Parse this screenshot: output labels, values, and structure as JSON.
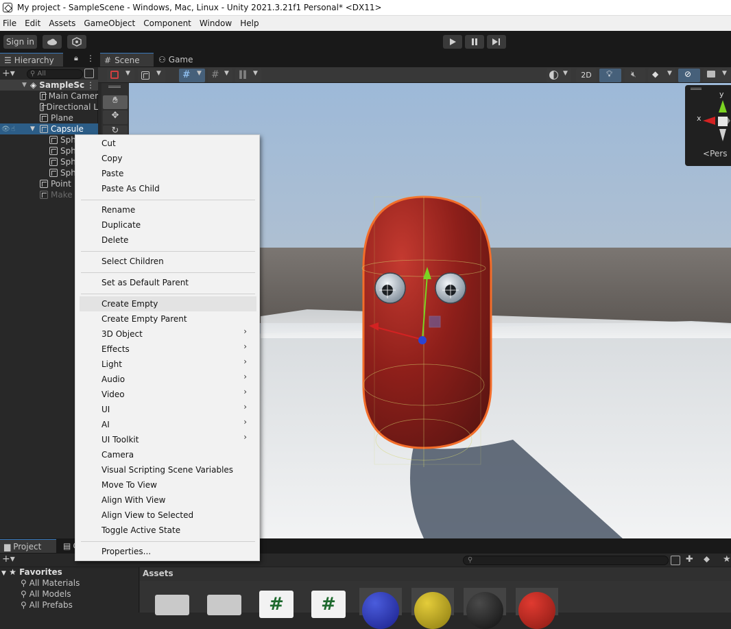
{
  "window": {
    "title": "My project - SampleScene - Windows, Mac, Linux - Unity 2021.3.21f1 Personal* <DX11>"
  },
  "menubar": [
    "File",
    "Edit",
    "Assets",
    "GameObject",
    "Component",
    "Window",
    "Help"
  ],
  "toolbar": {
    "sign_in": "Sign in"
  },
  "hierarchy": {
    "tab": "Hierarchy",
    "search_placeholder": "All",
    "scene": "SampleSc",
    "items": [
      "Main Camer",
      "Directional L",
      "Plane",
      "Capsule",
      "Sph",
      "Sph",
      "Sph",
      "Sph",
      "Point",
      "Make"
    ]
  },
  "scene": {
    "tabs": [
      "Scene",
      "Game"
    ],
    "btn_2d": "2D",
    "gizmo": {
      "y": "y",
      "x": "x",
      "persp": "Pers"
    }
  },
  "context_menu": {
    "items": [
      {
        "label": "Cut"
      },
      {
        "label": "Copy"
      },
      {
        "label": "Paste"
      },
      {
        "label": "Paste As Child"
      },
      {
        "label": "Rename"
      },
      {
        "label": "Duplicate"
      },
      {
        "label": "Delete"
      },
      {
        "label": "Select Children"
      },
      {
        "label": "Set as Default Parent"
      },
      {
        "label": "Create Empty"
      },
      {
        "label": "Create Empty Parent"
      },
      {
        "label": "3D Object"
      },
      {
        "label": "Effects"
      },
      {
        "label": "Light"
      },
      {
        "label": "Audio"
      },
      {
        "label": "Video"
      },
      {
        "label": "UI"
      },
      {
        "label": "AI"
      },
      {
        "label": "UI Toolkit"
      },
      {
        "label": "Camera"
      },
      {
        "label": "Visual Scripting Scene Variables"
      },
      {
        "label": "Move To View"
      },
      {
        "label": "Align With View"
      },
      {
        "label": "Align View to Selected"
      },
      {
        "label": "Toggle Active State"
      },
      {
        "label": "Properties..."
      }
    ]
  },
  "project": {
    "tabs": [
      "Project",
      "C"
    ],
    "favorites": "Favorites",
    "fav_items": [
      "All Materials",
      "All Models",
      "All Prefabs"
    ],
    "assets_header": "Assets"
  }
}
